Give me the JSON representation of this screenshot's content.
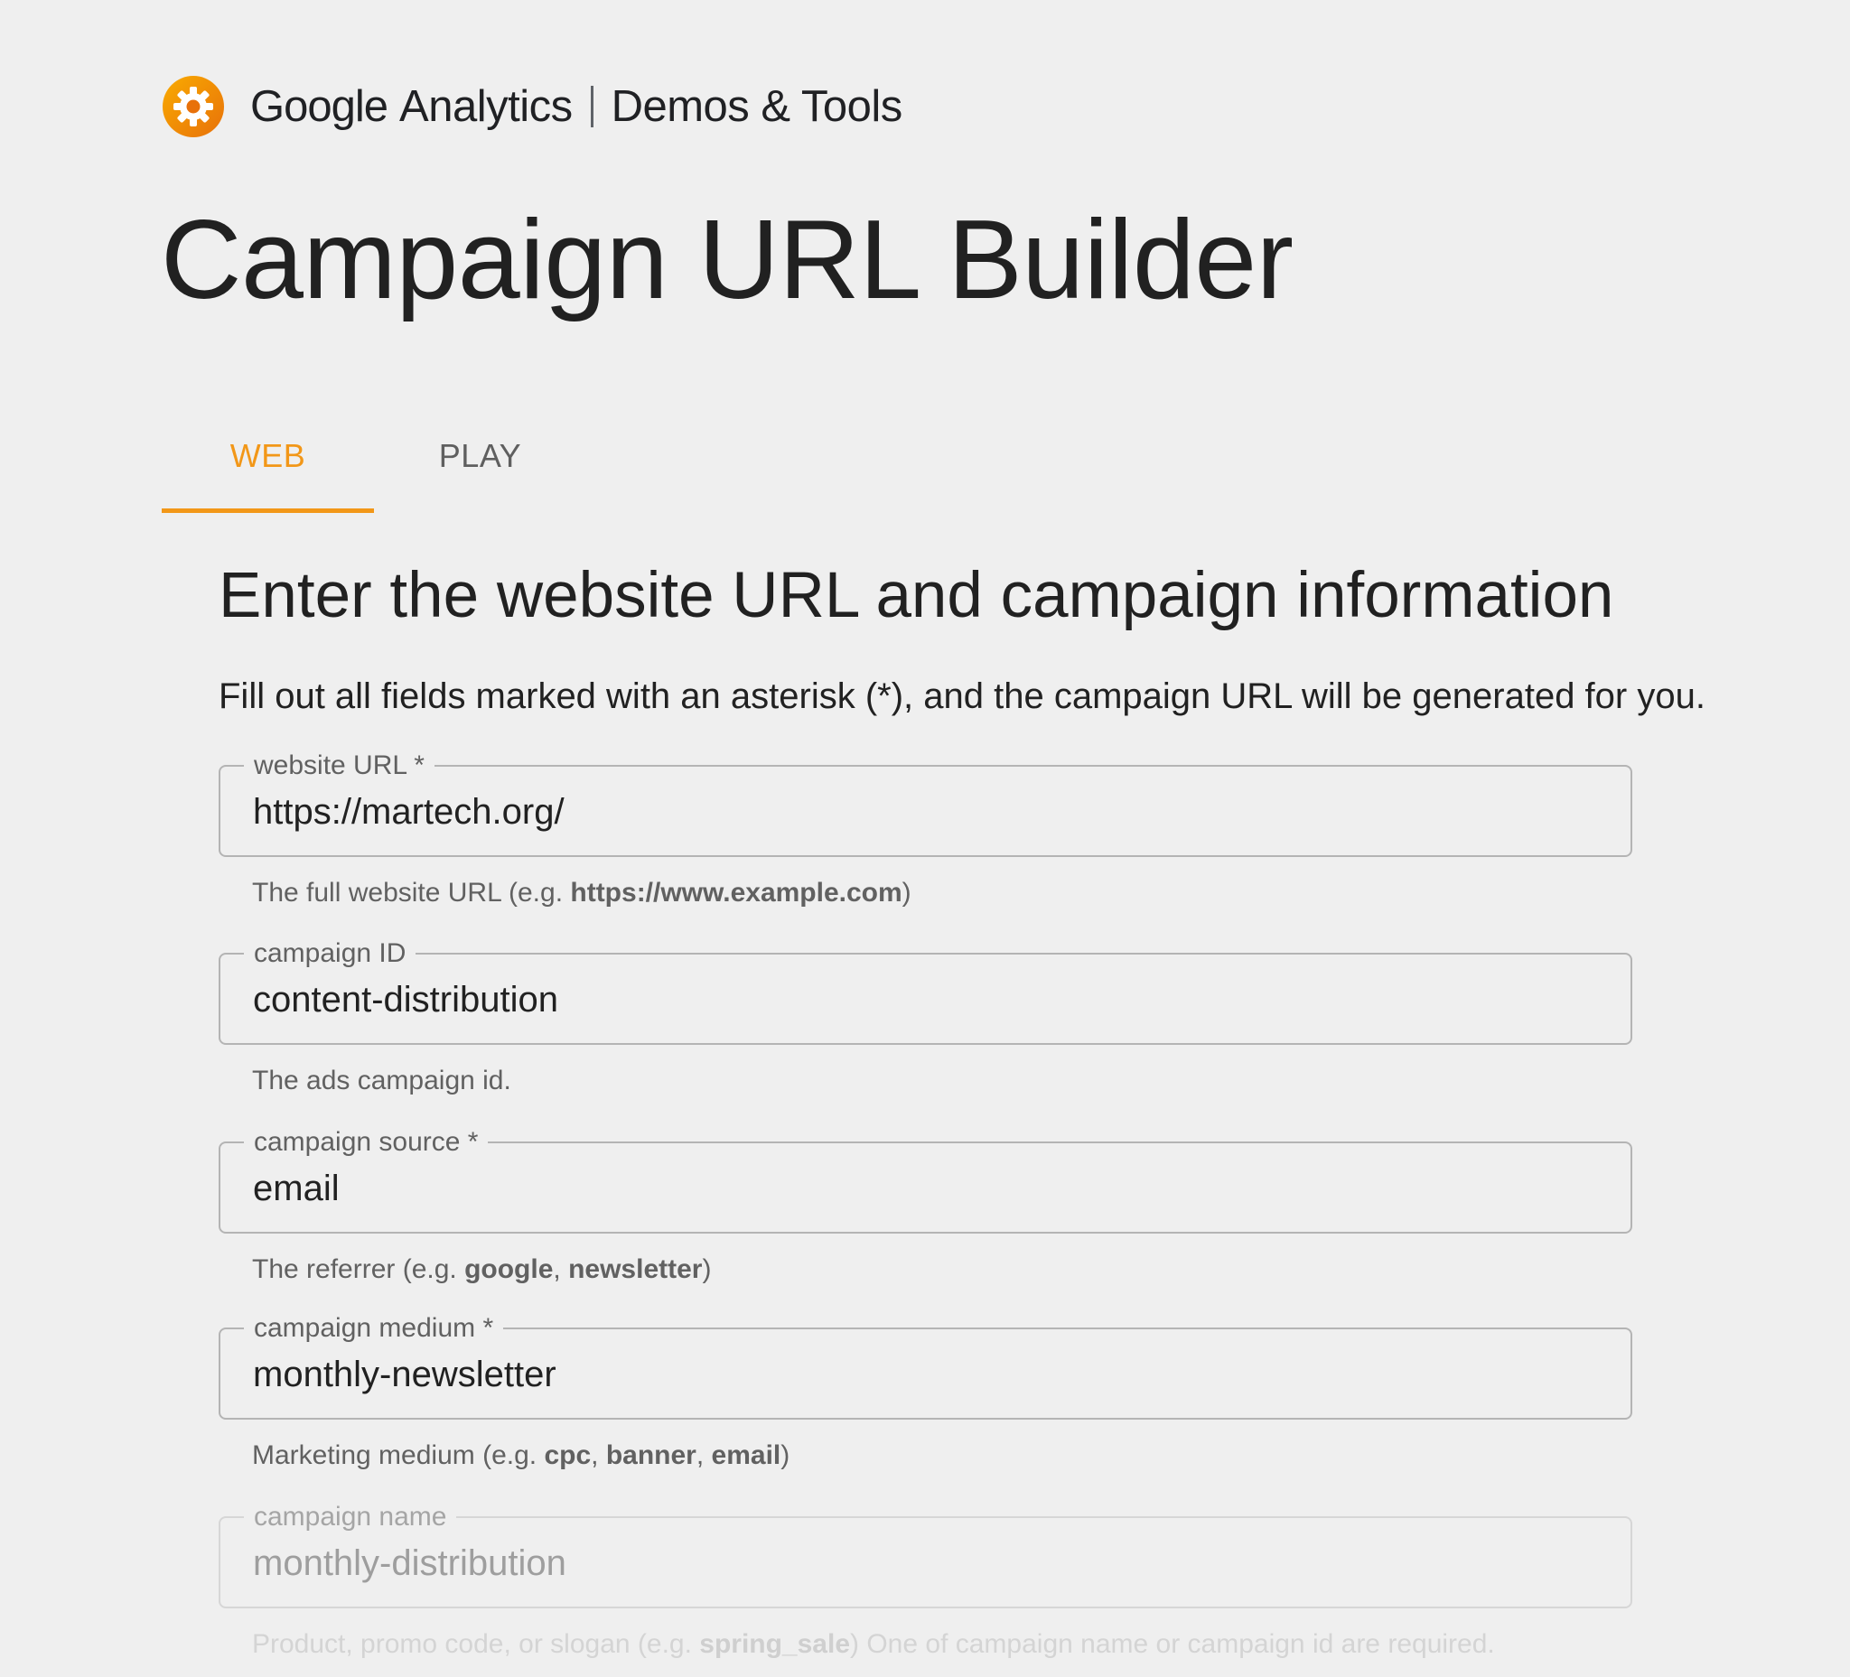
{
  "brand": {
    "logo_icon": "google-analytics-gear-icon",
    "google": "Google",
    "analytics": "Analytics",
    "section": "Demos & Tools",
    "accent_color": "#f29718"
  },
  "page": {
    "title": "Campaign URL Builder"
  },
  "tabs": [
    {
      "label": "WEB",
      "active": true
    },
    {
      "label": "PLAY",
      "active": false
    }
  ],
  "form": {
    "heading": "Enter the website URL and campaign information",
    "intro": "Fill out all fields marked with an asterisk (*), and the campaign URL will be generated for you.",
    "fields": [
      {
        "label": "website URL *",
        "value": "https://martech.org/",
        "help_prefix": "The full website URL (e.g. ",
        "help_example_1": "https://www.example.com",
        "help_suffix": ")"
      },
      {
        "label": "campaign ID",
        "value": "content-distribution",
        "help": "The ads campaign id."
      },
      {
        "label": "campaign source *",
        "value": "email",
        "help_prefix": "The referrer (e.g. ",
        "help_example_1": "google",
        "help_sep_1": ", ",
        "help_example_2": "newsletter",
        "help_suffix": ")"
      },
      {
        "label": "campaign medium *",
        "value": "monthly-newsletter",
        "help_prefix": "Marketing medium (e.g. ",
        "help_example_1": "cpc",
        "help_sep_1": ", ",
        "help_example_2": "banner",
        "help_sep_2": ", ",
        "help_example_3": "email",
        "help_suffix": ")"
      },
      {
        "label": "campaign name",
        "value": "monthly-distribution",
        "help_prefix": "Product, promo code, or slogan (e.g. ",
        "help_example_1": "spring_sale",
        "help_suffix": ") One of campaign name or campaign id are required."
      }
    ]
  }
}
